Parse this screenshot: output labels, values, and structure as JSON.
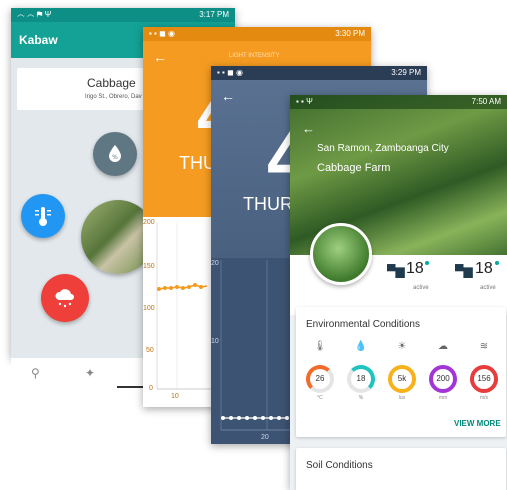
{
  "phone1": {
    "status_time": "3:17 PM",
    "status_left": "෴ ෴ ⚑ Ψ",
    "app_title": "Kabaw",
    "card_title": "Cabbage",
    "card_address": "Irigo St., Obrero, Dav"
  },
  "phone2": {
    "status_time": "3:30 PM",
    "title": "LIGHT INTENSITY",
    "big_number": "4",
    "day": "THU",
    "y_ticks": [
      "200",
      "150",
      "100",
      "50",
      "0"
    ],
    "x_tick": "10"
  },
  "phone3": {
    "status_time": "3:29 PM",
    "big_number": "4",
    "day": "THURS",
    "y_ticks": [
      "20",
      "10"
    ],
    "x_tick": "20"
  },
  "phone4": {
    "status_time": "7:50 AM",
    "location": "San Ramon, Zamboanga City",
    "farm_name": "Cabbage Farm",
    "sensor1_value": "18",
    "sensor1_status": "active",
    "sensor2_value": "18",
    "sensor2_status": "active",
    "env_title": "Environmental Conditions",
    "view_more": "VIEW MORE",
    "soil_title": "Soil Conditions",
    "gauges": [
      {
        "value": "26",
        "unit": "°C",
        "color": "#f26b2a"
      },
      {
        "value": "18",
        "unit": "%",
        "color": "#1fc3c0"
      },
      {
        "value": "5k",
        "unit": "lux",
        "color": "#f7b21b"
      },
      {
        "value": "200",
        "unit": "mm",
        "color": "#a335d6"
      },
      {
        "value": "156",
        "unit": "m/s",
        "color": "#e83b3b"
      }
    ]
  },
  "colors": {
    "teal": "#14a196",
    "orange": "#f59b21",
    "slate": "#4a6280",
    "green_accent": "#00a99d"
  }
}
